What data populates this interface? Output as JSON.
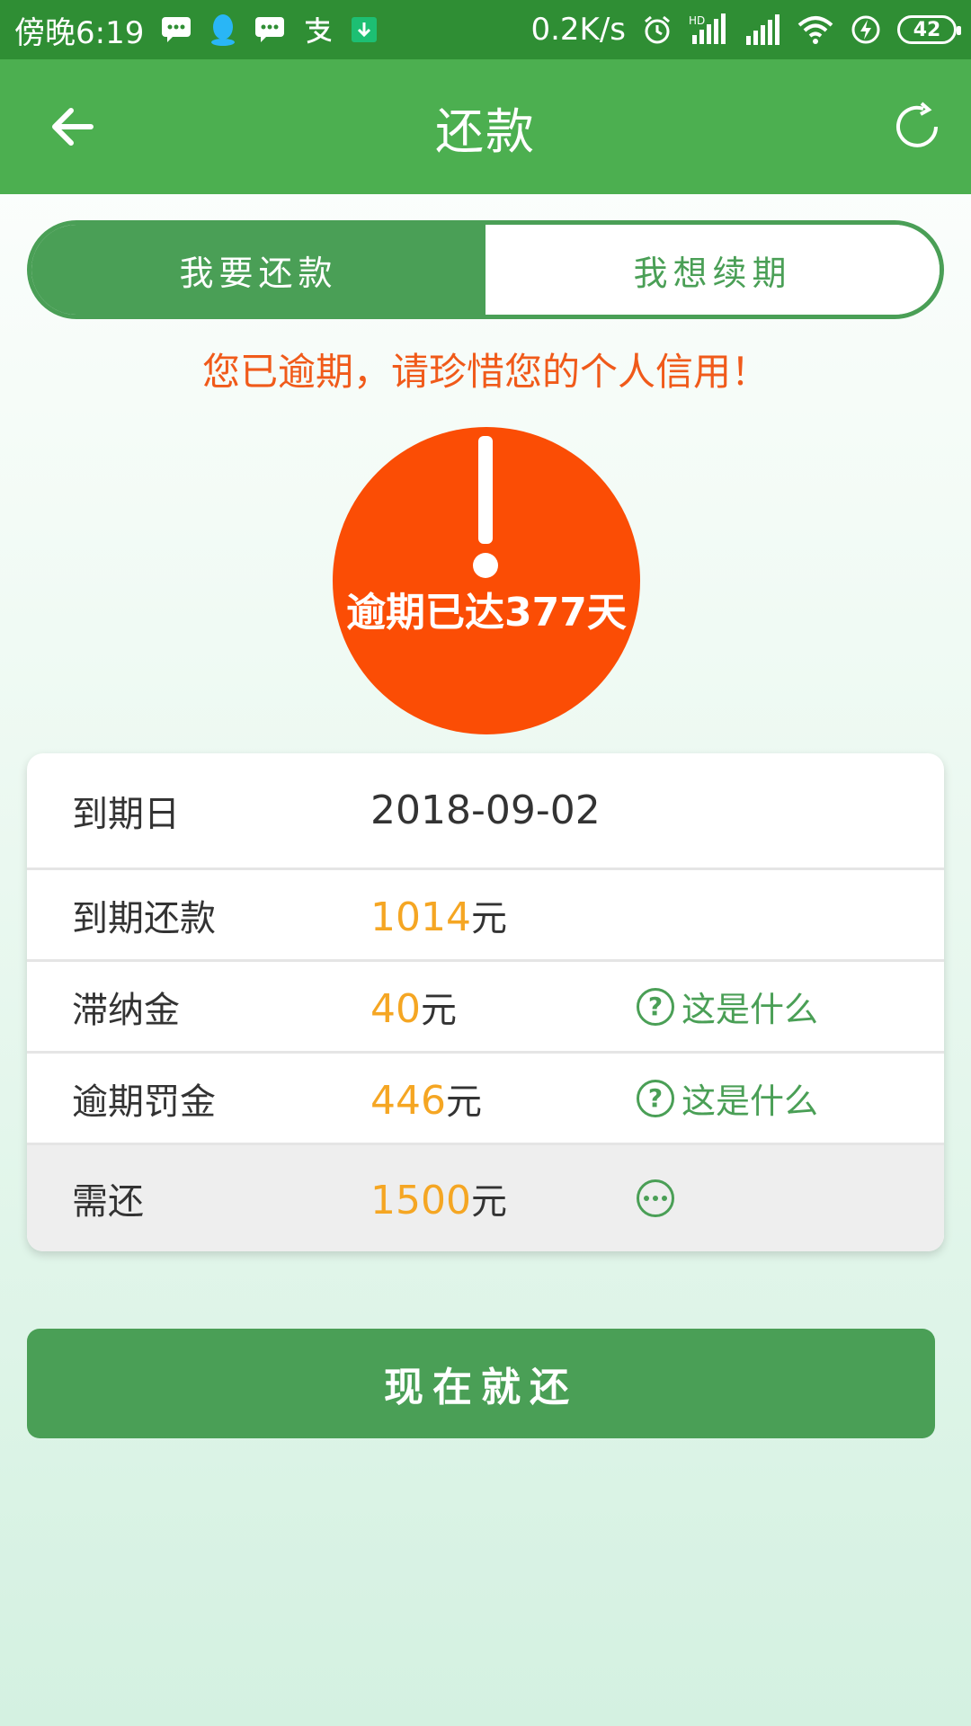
{
  "status_bar": {
    "time": "傍晚6:19",
    "net_speed": "0.2K/s",
    "hd": "HD",
    "battery": "42"
  },
  "header": {
    "title": "还款"
  },
  "segment": {
    "repay_label": "我要还款",
    "renew_label": "我想续期"
  },
  "warning_text": "您已逾期，请珍惜您的个人信用！",
  "overdue": {
    "text": "逾期已达377天"
  },
  "details": {
    "due_date_label": "到期日",
    "due_date_value": "2018-09-02",
    "due_amount_label": "到期还款",
    "due_amount_num": "1014",
    "late_fee_label": "滞纳金",
    "late_fee_num": "40",
    "penalty_label": "逾期罚金",
    "penalty_num": "446",
    "total_label": "需还",
    "total_num": "1500",
    "unit": "元",
    "help_text": "这是什么"
  },
  "pay_button": "现在就还",
  "colors": {
    "primary_green": "#4a9f56",
    "header_green": "#4caf50",
    "status_green": "#2f8e34",
    "warning_orange": "#f05a1a",
    "circle_orange": "#fb4d05",
    "amount_yellow": "#f5a623"
  }
}
